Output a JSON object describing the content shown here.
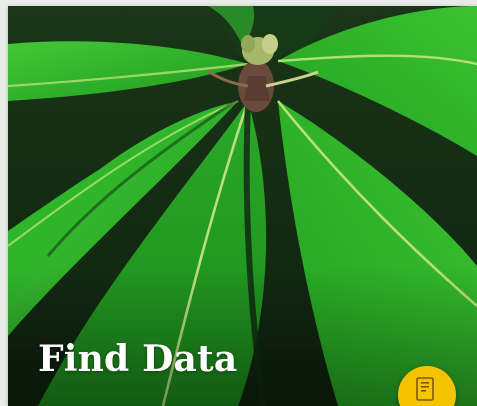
{
  "card": {
    "title": "Find Data",
    "image_subject": "rhododendron-leaves"
  },
  "fab": {
    "icon": "document-icon",
    "color": "#f5c400"
  },
  "colors": {
    "leaf_green": "#2fb52a",
    "leaf_midrib": "#b9e07a",
    "shadow_dark": "#0f2a10",
    "page_background": "#e9ece9"
  }
}
